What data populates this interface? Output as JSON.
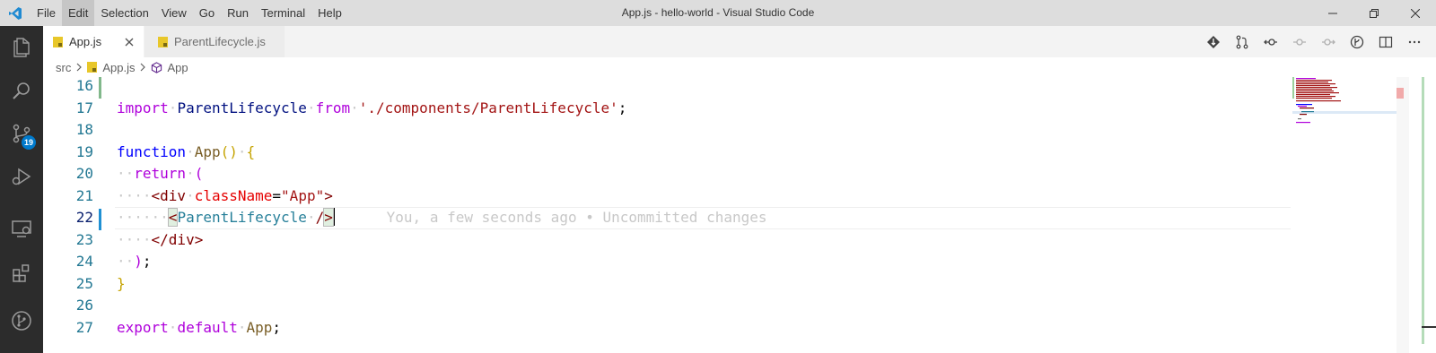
{
  "titlebar": {
    "window_title": "App.js - hello-world - Visual Studio Code",
    "menu": [
      "File",
      "Edit",
      "Selection",
      "View",
      "Go",
      "Run",
      "Terminal",
      "Help"
    ],
    "active_menu": "Edit",
    "accent": "#007acc"
  },
  "activity_bar": {
    "items": [
      "explorer-icon",
      "search-icon",
      "source-control-icon",
      "run-debug-icon",
      "remote-explorer-icon",
      "extensions-icon",
      "git-graph-icon"
    ],
    "source_control_badge": "19"
  },
  "tabs": [
    {
      "label": "App.js",
      "active": true
    },
    {
      "label": "ParentLifecycle.js",
      "active": false
    }
  ],
  "breadcrumb": {
    "folder": "src",
    "file": "App.js",
    "symbol": "App"
  },
  "editor": {
    "line_numbers": [
      "16",
      "17",
      "18",
      "19",
      "20",
      "21",
      "22",
      "23",
      "24",
      "25",
      "26",
      "27"
    ],
    "line17": {
      "kw_import": "import",
      "name": "ParentLifecycle",
      "kw_from": "from",
      "path": "'./components/ParentLifecycle'",
      "semi": ";"
    },
    "line19": {
      "kw": "function",
      "name": "App",
      "parens": "()",
      "brace": "{"
    },
    "line20": {
      "kw": "return",
      "paren": "("
    },
    "line21": {
      "open": "<div",
      "attr": "className",
      "eq": "=",
      "val": "\"App\"",
      "close": ">"
    },
    "line22": {
      "lt": "<",
      "comp": "ParentLifecycle",
      "end": "/",
      "gt": ">"
    },
    "line23": {
      "tag": "</div>"
    },
    "line24": {
      "paren": ")",
      "semi": ";"
    },
    "line25": {
      "brace": "}"
    },
    "line27": {
      "kw": "export",
      "kw2": "default",
      "name": "App",
      "semi": ";"
    },
    "blame": "You, a few seconds ago • Uncommitted changes"
  }
}
